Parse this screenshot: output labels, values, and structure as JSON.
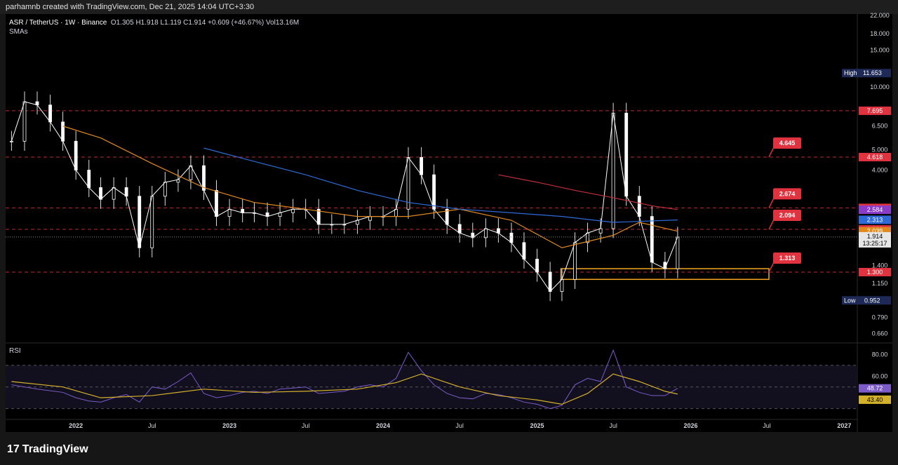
{
  "header": {
    "credit": "parhamnb created with TradingView.com, Dec 21, 2025 14:04 UTC+3:30"
  },
  "legend": {
    "symbol": "ASR / TetherUS · 1W · Binance",
    "ohlc": "O1.305  H1.918  L1.119  C1.914  +0.609 (+46.67%)  Vol13.16M",
    "indicator": "SMAs"
  },
  "rsi_label": "RSI",
  "brand": {
    "logo": "17",
    "name": "TradingView"
  },
  "colors": {
    "bg": "#000000",
    "up": "#ffffff",
    "down": "#ffffff",
    "sma50": "#e08a1e",
    "sma100": "#2f6bd8",
    "sma200": "#c0303a",
    "level": "#e0333f",
    "rsi": "#7d5cc9",
    "rsi_ma": "#d4b12a",
    "box": "#f5a623"
  },
  "chart_data": [
    {
      "type": "candlestick",
      "title": "ASR / TetherUS · 1W · Binance",
      "y_scale": "log",
      "ylim": [
        0.6,
        22
      ],
      "x_ticks": [
        "2022",
        "Jul",
        "2023",
        "Jul",
        "2024",
        "Jul",
        "2025",
        "Jul",
        "2026",
        "Jul",
        "2027"
      ],
      "y_ticks": [
        "22.000",
        "18.000",
        "15.000",
        "10.000",
        "6.500",
        "5.000",
        "4.000",
        "1.400",
        "1.150",
        "0.790",
        "0.660"
      ],
      "last_price": "1.914",
      "countdown": "13:25:17",
      "high_label": {
        "text": "High",
        "value": "11.653"
      },
      "low_label": {
        "text": "Low",
        "value": "0.952"
      },
      "levels": [
        {
          "value": "7.695",
          "color": "#e0333f"
        },
        {
          "value": "4.618",
          "color": "#e0333f"
        },
        {
          "value": "2.638",
          "color": "#e0333f"
        },
        {
          "value": "2.082",
          "color": "#e0333f"
        },
        {
          "value": "1.300",
          "color": "#e0333f"
        }
      ],
      "sma_axis_labels": [
        {
          "value": "2.584",
          "color": "#8a3cc8"
        },
        {
          "value": "2.313",
          "color": "#2f6bd8"
        },
        {
          "value": "2.039",
          "color": "#e08a1e"
        }
      ],
      "callouts": [
        "4.645",
        "2.674",
        "2.094",
        "1.313"
      ],
      "support_zone": [
        1.2,
        1.35
      ],
      "series": [
        {
          "name": "price",
          "points": [
            [
              "2021-08",
              5.5
            ],
            [
              "2021-09",
              8.5
            ],
            [
              "2021-10",
              8.2
            ],
            [
              "2021-11",
              6.8
            ],
            [
              "2021-12",
              5.5
            ],
            [
              "2022-01",
              4.0
            ],
            [
              "2022-02",
              3.3
            ],
            [
              "2022-03",
              2.9
            ],
            [
              "2022-04",
              3.3
            ],
            [
              "2022-05",
              3.0
            ],
            [
              "2022-06",
              1.7
            ],
            [
              "2022-07",
              3.0
            ],
            [
              "2022-08",
              3.5
            ],
            [
              "2022-09",
              3.6
            ],
            [
              "2022-10",
              4.2
            ],
            [
              "2022-11",
              3.2
            ],
            [
              "2022-12",
              2.4
            ],
            [
              "2023-01",
              2.6
            ],
            [
              "2023-02",
              2.5
            ],
            [
              "2023-03",
              2.5
            ],
            [
              "2023-04",
              2.4
            ],
            [
              "2023-05",
              2.5
            ],
            [
              "2023-06",
              2.6
            ],
            [
              "2023-07",
              2.6
            ],
            [
              "2023-08",
              2.2
            ],
            [
              "2023-09",
              2.2
            ],
            [
              "2023-10",
              2.2
            ],
            [
              "2023-11",
              2.3
            ],
            [
              "2023-12",
              2.4
            ],
            [
              "2024-01",
              2.4
            ],
            [
              "2024-02",
              2.6
            ],
            [
              "2024-03",
              4.6
            ],
            [
              "2024-04",
              3.8
            ],
            [
              "2024-05",
              2.6
            ],
            [
              "2024-06",
              2.2
            ],
            [
              "2024-07",
              2.0
            ],
            [
              "2024-08",
              1.9
            ],
            [
              "2024-09",
              2.1
            ],
            [
              "2024-10",
              2.0
            ],
            [
              "2024-11",
              1.8
            ],
            [
              "2024-12",
              1.5
            ],
            [
              "2025-01",
              1.3
            ],
            [
              "2025-02",
              1.05
            ],
            [
              "2025-03",
              1.2
            ],
            [
              "2025-04",
              1.8
            ],
            [
              "2025-05",
              2.0
            ],
            [
              "2025-06",
              2.1
            ],
            [
              "2025-07",
              7.5
            ],
            [
              "2025-08",
              3.0
            ],
            [
              "2025-09",
              2.4
            ],
            [
              "2025-10",
              1.45
            ],
            [
              "2025-11",
              1.35
            ],
            [
              "2025-12",
              1.914
            ]
          ]
        },
        {
          "name": "SMA 50",
          "points": [
            [
              "2021-12",
              6.5
            ],
            [
              "2022-03",
              5.7
            ],
            [
              "2022-07",
              4.3
            ],
            [
              "2022-11",
              3.3
            ],
            [
              "2023-03",
              2.8
            ],
            [
              "2023-07",
              2.6
            ],
            [
              "2023-11",
              2.4
            ],
            [
              "2024-03",
              2.4
            ],
            [
              "2024-07",
              2.6
            ],
            [
              "2024-11",
              2.3
            ],
            [
              "2025-03",
              1.7
            ],
            [
              "2025-07",
              1.95
            ],
            [
              "2025-09",
              2.25
            ],
            [
              "2025-12",
              2.04
            ]
          ]
        },
        {
          "name": "SMA 100",
          "points": [
            [
              "2022-11",
              5.1
            ],
            [
              "2023-03",
              4.4
            ],
            [
              "2023-07",
              3.8
            ],
            [
              "2023-11",
              3.2
            ],
            [
              "2024-03",
              2.8
            ],
            [
              "2024-07",
              2.6
            ],
            [
              "2024-11",
              2.5
            ],
            [
              "2025-03",
              2.4
            ],
            [
              "2025-07",
              2.25
            ],
            [
              "2025-12",
              2.31
            ]
          ]
        },
        {
          "name": "SMA 200",
          "points": [
            [
              "2024-10",
              3.8
            ],
            [
              "2025-01",
              3.5
            ],
            [
              "2025-04",
              3.2
            ],
            [
              "2025-07",
              2.95
            ],
            [
              "2025-10",
              2.7
            ],
            [
              "2025-12",
              2.59
            ]
          ]
        }
      ]
    },
    {
      "type": "line",
      "title": "RSI",
      "ylim": [
        20,
        90
      ],
      "y_ticks": [
        "80.00",
        "60.00"
      ],
      "bands": [
        70,
        50,
        30
      ],
      "current": {
        "rsi": "48.72",
        "ma": "43.40"
      },
      "series": [
        {
          "name": "RSI",
          "points": [
            [
              "2021-08",
              52
            ],
            [
              "2021-10",
              48
            ],
            [
              "2021-12",
              45
            ],
            [
              "2022-01",
              40
            ],
            [
              "2022-02",
              37
            ],
            [
              "2022-03",
              36
            ],
            [
              "2022-04",
              40
            ],
            [
              "2022-05",
              43
            ],
            [
              "2022-06",
              36
            ],
            [
              "2022-07",
              50
            ],
            [
              "2022-08",
              48
            ],
            [
              "2022-09",
              55
            ],
            [
              "2022-10",
              63
            ],
            [
              "2022-11",
              44
            ],
            [
              "2022-12",
              40
            ],
            [
              "2023-01",
              42
            ],
            [
              "2023-02",
              45
            ],
            [
              "2023-03",
              46
            ],
            [
              "2023-04",
              44
            ],
            [
              "2023-05",
              48
            ],
            [
              "2023-06",
              49
            ],
            [
              "2023-07",
              50
            ],
            [
              "2023-08",
              44
            ],
            [
              "2023-09",
              45
            ],
            [
              "2023-10",
              46
            ],
            [
              "2023-11",
              50
            ],
            [
              "2023-12",
              52
            ],
            [
              "2024-01",
              50
            ],
            [
              "2024-02",
              58
            ],
            [
              "2024-03",
              82
            ],
            [
              "2024-04",
              65
            ],
            [
              "2024-05",
              52
            ],
            [
              "2024-06",
              44
            ],
            [
              "2024-07",
              40
            ],
            [
              "2024-08",
              39
            ],
            [
              "2024-09",
              44
            ],
            [
              "2024-10",
              43
            ],
            [
              "2024-11",
              40
            ],
            [
              "2024-12",
              36
            ],
            [
              "2025-01",
              34
            ],
            [
              "2025-02",
              30
            ],
            [
              "2025-03",
              33
            ],
            [
              "2025-04",
              52
            ],
            [
              "2025-05",
              58
            ],
            [
              "2025-06",
              55
            ],
            [
              "2025-07",
              84
            ],
            [
              "2025-08",
              50
            ],
            [
              "2025-09",
              45
            ],
            [
              "2025-10",
              42
            ],
            [
              "2025-11",
              42
            ],
            [
              "2025-12",
              48.72
            ]
          ]
        },
        {
          "name": "RSI MA",
          "points": [
            [
              "2021-08",
              55
            ],
            [
              "2021-12",
              50
            ],
            [
              "2022-03",
              40
            ],
            [
              "2022-07",
              42
            ],
            [
              "2022-11",
              48
            ],
            [
              "2023-03",
              45
            ],
            [
              "2023-07",
              46
            ],
            [
              "2023-11",
              48
            ],
            [
              "2024-02",
              54
            ],
            [
              "2024-04",
              62
            ],
            [
              "2024-07",
              50
            ],
            [
              "2024-10",
              42
            ],
            [
              "2025-01",
              38
            ],
            [
              "2025-03",
              34
            ],
            [
              "2025-05",
              44
            ],
            [
              "2025-07",
              62
            ],
            [
              "2025-09",
              55
            ],
            [
              "2025-11",
              46
            ],
            [
              "2025-12",
              43.4
            ]
          ]
        }
      ]
    }
  ]
}
